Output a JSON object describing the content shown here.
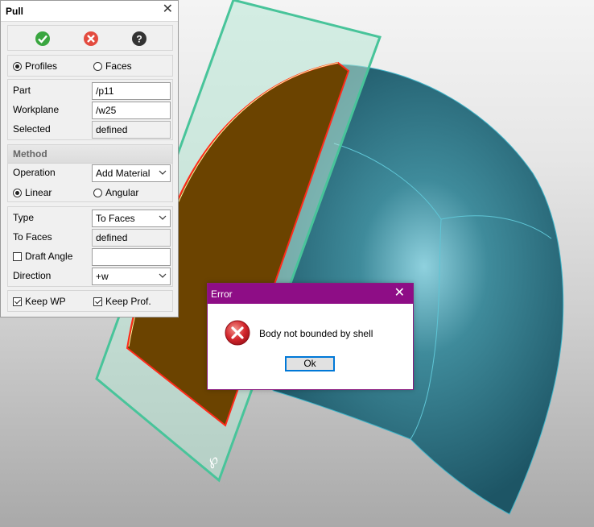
{
  "panel": {
    "title": "Pull",
    "close_glyph": "✕",
    "actions": [
      {
        "name": "ok-icon",
        "color": "#3aa640"
      },
      {
        "name": "cancel-icon",
        "color": "#e34b3f"
      },
      {
        "name": "help-icon",
        "color": "#333333"
      }
    ],
    "mode": {
      "option1": "Profiles",
      "option2": "Faces",
      "selected": "Profiles"
    },
    "part": {
      "label": "Part",
      "value": "/p11"
    },
    "workplane": {
      "label": "Workplane",
      "value": "/w25"
    },
    "selected": {
      "label": "Selected",
      "value": "defined"
    },
    "method": {
      "title": "Method",
      "operation_label": "Operation",
      "operation_value": "Add Material",
      "linear": "Linear",
      "angular": "Angular",
      "selected": "Linear"
    },
    "type": {
      "label": "Type",
      "value": "To Faces"
    },
    "to_faces": {
      "label": "To Faces",
      "value": "defined"
    },
    "draft_angle": {
      "label": "Draft Angle",
      "checked": false,
      "value": ""
    },
    "direction": {
      "label": "Direction",
      "value": "+w"
    },
    "keep_wp": {
      "label": "Keep WP",
      "checked": true
    },
    "keep_prof": {
      "label": "Keep Prof.",
      "checked": true
    }
  },
  "dialog": {
    "title": "Error",
    "close_glyph": "✕",
    "message": "Body not bounded by shell",
    "ok_label": "Ok",
    "icon": "error-icon",
    "title_color": "#8e0d86"
  },
  "viewport": {
    "profile_color": "#6b4300",
    "shell_color": "#1d5d6c",
    "workplane_color": "#48c49a"
  }
}
